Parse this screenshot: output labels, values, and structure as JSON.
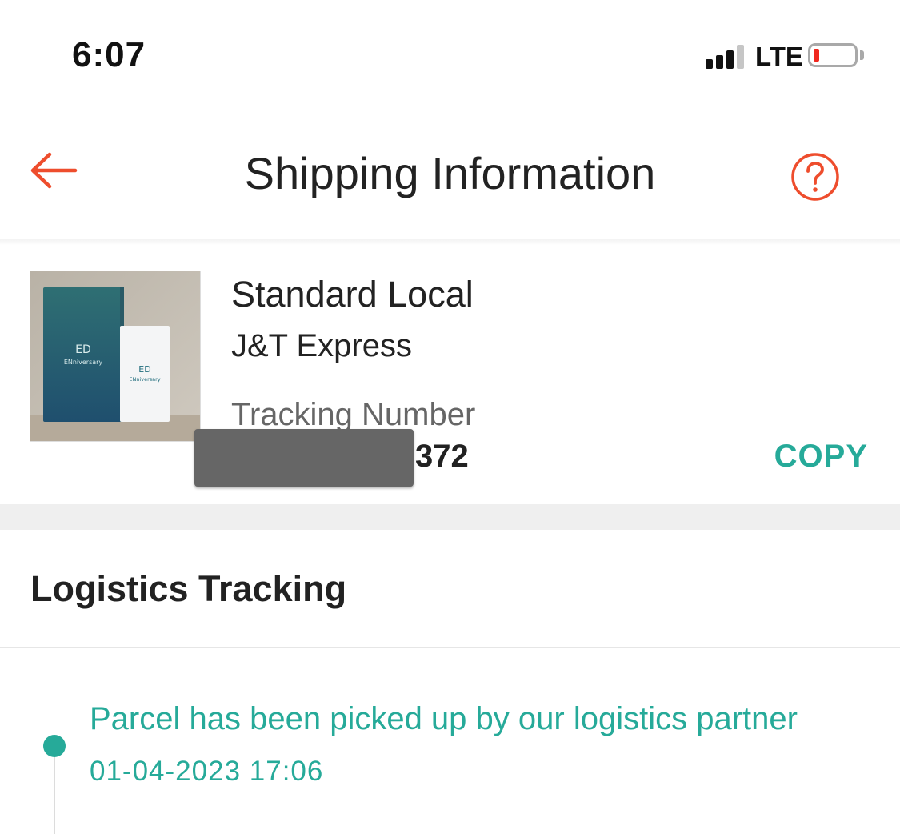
{
  "status_bar": {
    "time": "6:07",
    "network": "LTE",
    "battery_level": 0.1
  },
  "header": {
    "title": "Shipping Information",
    "back_icon": "arrow-left-icon",
    "help_icon": "question-circle-icon",
    "accent_color": "#ee4d2d"
  },
  "shipment": {
    "type": "Standard Local",
    "carrier": "J&T Express",
    "tracking_label": "Tracking Number",
    "tracking_number_visible": "372",
    "copy_label": "COPY",
    "copy_color": "#26aa99",
    "product_image_text": [
      "ENniversary",
      "ENniversary"
    ]
  },
  "logistics": {
    "title": "Logistics Tracking",
    "events": [
      {
        "text": "Parcel has been picked up by our logistics partner",
        "time": "01-04-2023 17:06"
      }
    ],
    "status_color": "#26aa99"
  }
}
